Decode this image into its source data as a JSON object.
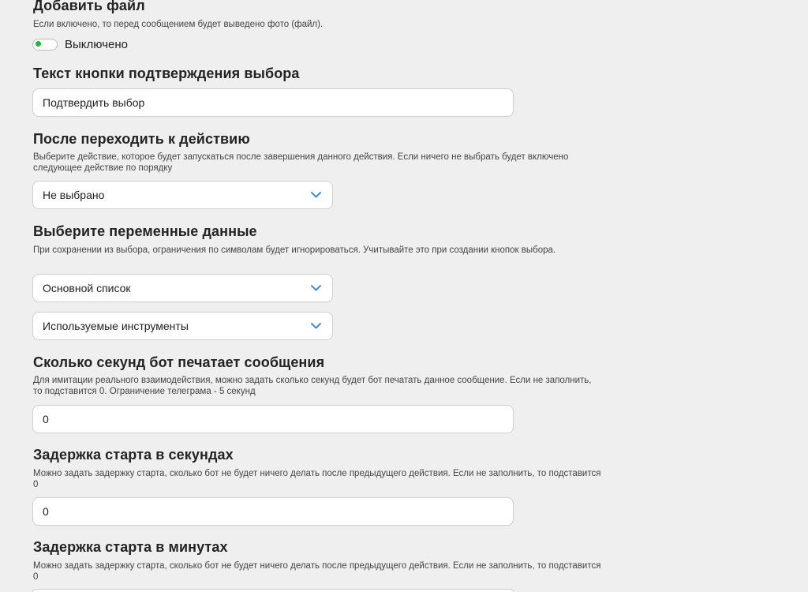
{
  "file_section": {
    "title": "Добавить файл",
    "description": "Если включено, то перед сообщением будет выведено фото (файл).",
    "toggle_label": "Выключено"
  },
  "confirm_button_section": {
    "title": "Текст кнопки подтверждения выбора",
    "value": "Подтвердить выбор"
  },
  "next_action_section": {
    "title": "После переходить к действию",
    "description": "Выберите действие, которое будет запускаться после завершения данного действия. Если ничего не выбрать будет включено следующее действие по порядку",
    "selected": "Не выбрано"
  },
  "variables_section": {
    "title": "Выберите переменные данные",
    "description": "При сохранении из выбора, ограничения по символам будет игнорироваться. Учитывайте это при создании кнопок выбора.",
    "select_1": "Основной список",
    "select_2": "Используемые инструменты"
  },
  "typing_section": {
    "title": "Сколько секунд бот печатает сообщения",
    "description": "Для имитации реального взаимодействия, можно задать сколько секунд будет бот печатать данное сообщение. Если не заполнить, то подставится 0. Ограничение телеграма - 5 секунд",
    "value": "0"
  },
  "delay_seconds_section": {
    "title": "Задержка старта в секундах",
    "description": "Можно задать задержку старта, сколько бот не будет ничего делать после предыдущего действия. Если не заполнить, то подставится 0",
    "value": "0"
  },
  "delay_minutes_section": {
    "title": "Задержка старта в минутах",
    "description": "Можно задать задержку старта, сколько бот не будет ничего делать после предыдущего действия. Если не заполнить, то подставится 0"
  },
  "colors": {
    "background": "#efefef",
    "toggle_dot": "#23b43f",
    "chevron": "#2b7fd6"
  },
  "icons": {
    "dropdown": "chevron-down-icon"
  }
}
